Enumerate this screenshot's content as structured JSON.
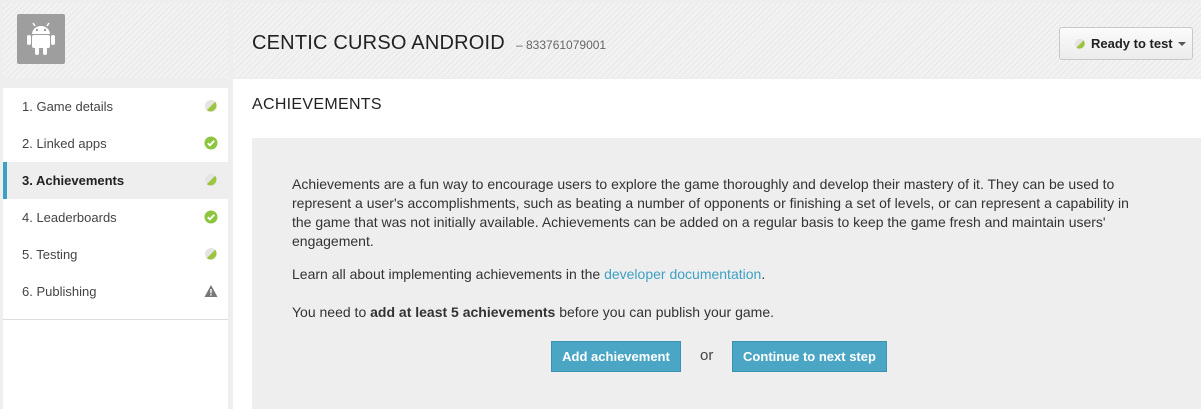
{
  "header": {
    "app_title": "CENTIC CURSO ANDROID",
    "app_id": "– 833761079001",
    "status_label": "Ready to test"
  },
  "sidebar": {
    "items": [
      {
        "label": "1. Game details",
        "status": "partial"
      },
      {
        "label": "2. Linked apps",
        "status": "complete"
      },
      {
        "label": "3. Achievements",
        "status": "partial",
        "active": true
      },
      {
        "label": "4. Leaderboards",
        "status": "complete"
      },
      {
        "label": "5. Testing",
        "status": "partial"
      },
      {
        "label": "6. Publishing",
        "status": "warning"
      }
    ]
  },
  "main": {
    "section_title": "ACHIEVEMENTS",
    "intro": "Achievements are a fun way to encourage users to explore the game thoroughly and develop their mastery of it. They can be used to represent a user's accomplishments, such as beating a number of opponents or finishing a set of levels, or can represent a capability in the game that was not initially available. Achievements can be added on a regular basis to keep the game fresh and maintain users' engagement.",
    "learn_prefix": "Learn all about implementing achievements in the ",
    "learn_link": "developer documentation",
    "learn_suffix": ".",
    "req_prefix": "You need to ",
    "req_bold": "add at least 5 achievements",
    "req_suffix": " before you can publish your game.",
    "add_button": "Add achievement",
    "or_text": "or",
    "continue_button": "Continue to next step"
  },
  "colors": {
    "accent": "#3ea0c4",
    "complete": "#8cc63f",
    "warning": "#777777"
  }
}
